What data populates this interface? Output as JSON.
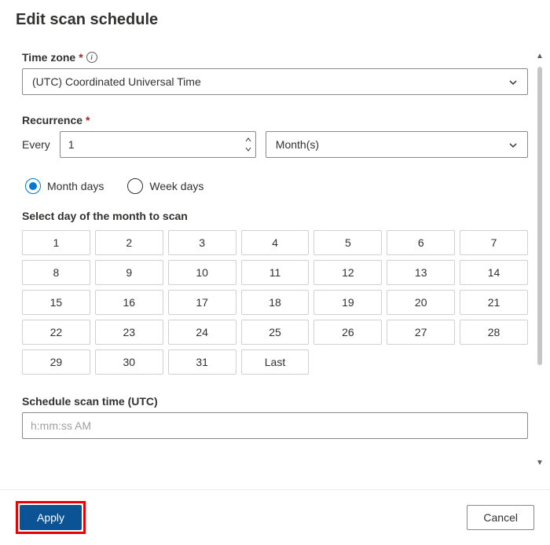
{
  "title": "Edit scan schedule",
  "timezone": {
    "label": "Time zone",
    "value": "(UTC) Coordinated Universal Time"
  },
  "recurrence": {
    "label": "Recurrence",
    "every_label": "Every",
    "every_value": "1",
    "unit": "Month(s)"
  },
  "day_mode": {
    "month_days": "Month days",
    "week_days": "Week days"
  },
  "select_day_label": "Select day of the month to scan",
  "days": [
    "1",
    "2",
    "3",
    "4",
    "5",
    "6",
    "7",
    "8",
    "9",
    "10",
    "11",
    "12",
    "13",
    "14",
    "15",
    "16",
    "17",
    "18",
    "19",
    "20",
    "21",
    "22",
    "23",
    "24",
    "25",
    "26",
    "27",
    "28",
    "29",
    "30",
    "31",
    "Last"
  ],
  "schedule_time": {
    "label": "Schedule scan time (UTC)",
    "placeholder": "h:mm:ss AM"
  },
  "buttons": {
    "apply": "Apply",
    "cancel": "Cancel"
  }
}
